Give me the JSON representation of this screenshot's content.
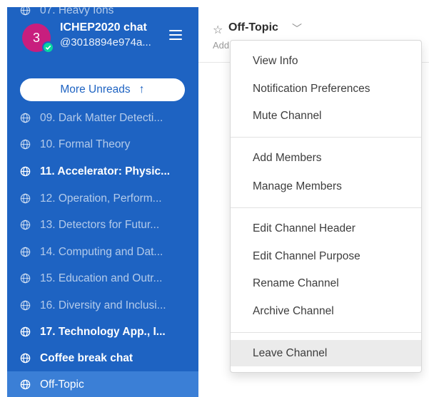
{
  "team": {
    "badge": "3",
    "name": "ICHEP2020 chat",
    "user": "@3018894e974a..."
  },
  "sidebar": {
    "cut_channel": "07. Heavy Ions",
    "more_unreads": "More Unreads",
    "channels": [
      {
        "label": "09. Dark Matter Detecti...",
        "state": "read"
      },
      {
        "label": "10. Formal Theory",
        "state": "read"
      },
      {
        "label": "11. Accelerator: Physic...",
        "state": "unread"
      },
      {
        "label": "12. Operation, Perform...",
        "state": "read"
      },
      {
        "label": "13. Detectors for Futur...",
        "state": "read"
      },
      {
        "label": "14. Computing and Dat...",
        "state": "read"
      },
      {
        "label": "15. Education and Outr...",
        "state": "read"
      },
      {
        "label": "16. Diversity and Inclusi...",
        "state": "read"
      },
      {
        "label": "17. Technology App., I...",
        "state": "unread"
      },
      {
        "label": "Coffee break chat",
        "state": "unread"
      },
      {
        "label": "Off-Topic",
        "state": "active"
      }
    ]
  },
  "header": {
    "channel_name": "Off-Topic",
    "subtitle": "Add"
  },
  "menu": {
    "view_info": "View Info",
    "notification_preferences": "Notification Preferences",
    "mute_channel": "Mute Channel",
    "add_members": "Add Members",
    "manage_members": "Manage Members",
    "edit_channel_header": "Edit Channel Header",
    "edit_channel_purpose": "Edit Channel Purpose",
    "rename_channel": "Rename Channel",
    "archive_channel": "Archive Channel",
    "leave_channel": "Leave Channel"
  },
  "colors": {
    "sidebar_bg": "#1e63c2",
    "active_channel_bg": "#3b7fd6",
    "badge_bg": "#c81e7e",
    "online_status": "#06d6a0"
  }
}
